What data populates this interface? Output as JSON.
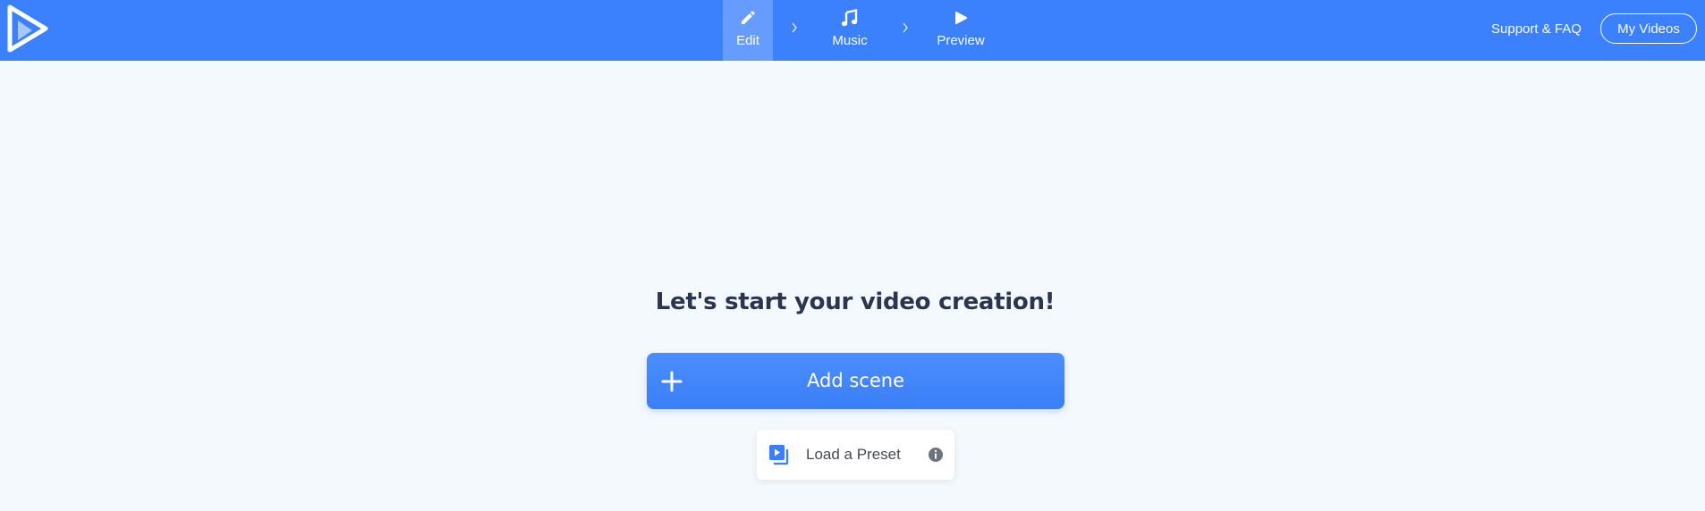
{
  "header": {
    "steps": [
      {
        "label": "Edit",
        "icon": "pencil-icon",
        "active": true
      },
      {
        "label": "Music",
        "icon": "music-note-icon",
        "active": false
      },
      {
        "label": "Preview",
        "icon": "play-icon",
        "active": false
      }
    ],
    "support_link": "Support & FAQ",
    "my_videos_label": "My Videos"
  },
  "main": {
    "headline": "Let's start your video creation!",
    "add_scene_label": "Add scene",
    "load_preset_label": "Load a Preset"
  },
  "colors": {
    "brand": "#3b80fd",
    "background": "#f4f9fd",
    "heading_text": "#2a3550",
    "info_icon": "#6b7380"
  }
}
